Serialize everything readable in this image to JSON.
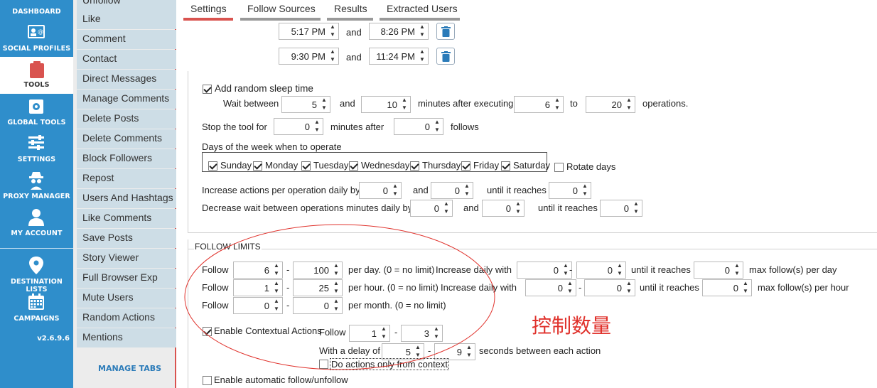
{
  "nav": {
    "items": [
      {
        "label": "DASHBOARD",
        "icon": "dashboard-icon"
      },
      {
        "label": "SOCIAL PROFILES",
        "icon": "profiles-icon"
      },
      {
        "label": "TOOLS",
        "icon": "clipboard-icon"
      },
      {
        "label": "GLOBAL TOOLS",
        "icon": "global-tools-icon"
      },
      {
        "label": "SETTINGS",
        "icon": "sliders-icon"
      },
      {
        "label": "PROXY MANAGER",
        "icon": "spy-icon"
      },
      {
        "label": "MY ACCOUNT",
        "icon": "user-icon"
      },
      {
        "label": "DESTINATION LISTS",
        "icon": "map-pin-icon"
      },
      {
        "label": "CAMPAIGNS",
        "icon": "calendar-icon"
      }
    ],
    "version": "v2.6.9.6",
    "accent": "#2f8ecb"
  },
  "tools": {
    "top_partial": "Unfollow",
    "items": [
      "Like",
      "Comment",
      "Contact",
      "Direct Messages",
      "Manage Comments",
      "Delete Posts",
      "Delete Comments",
      "Block Followers",
      "Repost",
      "Users And Hashtags",
      "Like Comments",
      "Save Posts",
      "Story Viewer",
      "Full Browser Exp",
      "Mute Users",
      "Random Actions",
      "Mentions"
    ],
    "manage_tabs": "MANAGE TABS"
  },
  "tabs": [
    "Settings",
    "Follow Sources",
    "Results",
    "Extracted Users"
  ],
  "schedule": {
    "rows": [
      {
        "from": "5:17 PM",
        "and": "and",
        "to": "8:26 PM"
      },
      {
        "from": "9:30 PM",
        "and": "and",
        "to": "11:24 PM"
      }
    ]
  },
  "sleep": {
    "label": "Add random sleep time",
    "wait_between": "Wait between",
    "min": "5",
    "and": "and",
    "max": "10",
    "minutes_after": "minutes after executing",
    "ops_min": "6",
    "to": "to",
    "ops_max": "20",
    "operations": "operations."
  },
  "stop": {
    "label": "Stop the tool for",
    "minutes": "0",
    "minutes_after": "minutes after",
    "follows_value": "0",
    "follows": "follows"
  },
  "days": {
    "label": "Days of the week when to operate",
    "list": [
      "Sunday",
      "Monday",
      "Tuesday",
      "Wednesday",
      "Thursday",
      "Friday",
      "Saturday"
    ],
    "rotate": "Rotate days"
  },
  "increase": {
    "label": "Increase actions per operation daily by",
    "a": "0",
    "and": "and",
    "b": "0",
    "until": "until it reaches",
    "c": "0"
  },
  "decrease": {
    "label": "Decrease wait between operations minutes daily by",
    "a": "0",
    "and": "and",
    "b": "0",
    "until": "until it reaches",
    "c": "0"
  },
  "follow_limits": {
    "header": "FOLLOW LIMITS",
    "rows": [
      {
        "follow": "Follow",
        "min": "6",
        "dash": "-",
        "max": "100",
        "per": "per day. (0 = no limit)",
        "inc": "Increase daily with",
        "i1": "0",
        "i2": "0",
        "until": "until it reaches",
        "u": "0",
        "maxlbl": "max follow(s) per day"
      },
      {
        "follow": "Follow",
        "min": "1",
        "dash": "-",
        "max": "25",
        "per": "per hour. (0 = no limit)",
        "inc": "Increase daily with",
        "i1": "0",
        "i2": "0",
        "until": "until it reaches",
        "u": "0",
        "maxlbl": "max follow(s) per hour"
      },
      {
        "follow": "Follow",
        "min": "0",
        "dash": "-",
        "max": "0",
        "per": "per month. (0 = no limit)"
      }
    ]
  },
  "contextual": {
    "label": "Enable Contextual Actions",
    "follow": "Follow",
    "f1": "1",
    "dash": "-",
    "f2": "3",
    "delay": "With a delay of",
    "d1": "5",
    "d2": "9",
    "seconds": "seconds between each action",
    "only_context": "Do actions only from context"
  },
  "auto_follow": "Enable automatic follow/unfollow",
  "annotation": "控制数量"
}
